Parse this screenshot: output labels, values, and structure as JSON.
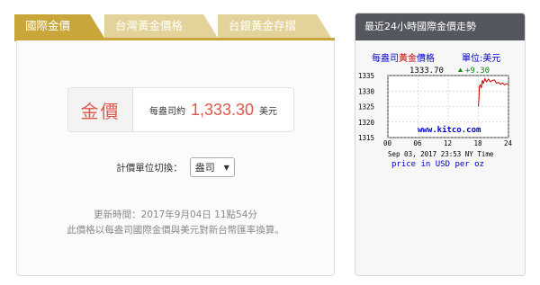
{
  "tabs": [
    {
      "label": "國際金價",
      "active": true
    },
    {
      "label": "台灣黃金價格",
      "active": false
    },
    {
      "label": "台銀黃金存摺",
      "active": false
    }
  ],
  "price": {
    "label": "金價",
    "per_unit": "每盎司約",
    "value": "1,333.30",
    "currency": "美元"
  },
  "unit_switch": {
    "label": "計價單位切換：",
    "selected": "盎司"
  },
  "update_time": "更新時間：2017年9月04日 11點54分",
  "note": "此價格以每盎司國際金價與美元對新台幣匯率換算。",
  "side": {
    "title": "最近24小時國際金價走勢",
    "chart": {
      "header_left_a": "每盎司",
      "header_left_b": "黃金",
      "header_left_c": "價格",
      "header_right": "單位:美元",
      "current": "1333.70",
      "change": "+9.30",
      "website": "www.kitco.com",
      "timestamp": "Sep 03, 2017 23:53 NY Time",
      "footer": "price in USD per oz"
    }
  },
  "colors": {
    "accent": "#c9a63a",
    "tab_inactive": "#e3d39a",
    "price_red": "#e0574a",
    "chart_blue": "#0000cc"
  },
  "chart_data": {
    "type": "line",
    "title": "每盎司黃金價格",
    "ylabel": "單位:美元",
    "xlim": [
      0,
      24
    ],
    "ylim": [
      1315,
      1335
    ],
    "yticks": [
      1315,
      1320,
      1325,
      1330,
      1335
    ],
    "xticks": [
      0,
      6,
      12,
      18,
      24
    ],
    "grid": true,
    "series": [
      {
        "values_x": [
          18.0,
          18.1,
          18.2,
          18.4,
          18.6,
          18.8,
          19.0,
          19.3,
          19.6,
          20.0,
          20.4,
          20.8,
          21.2,
          21.6,
          22.0,
          22.4,
          22.8,
          23.2,
          23.6,
          23.9
        ],
        "values_y": [
          1325.0,
          1327.0,
          1331.5,
          1332.0,
          1331.0,
          1333.5,
          1332.5,
          1334.0,
          1333.0,
          1333.8,
          1333.0,
          1333.4,
          1333.6,
          1332.5,
          1332.8,
          1332.2,
          1332.6,
          1332.0,
          1332.4,
          1332.2
        ]
      }
    ]
  }
}
